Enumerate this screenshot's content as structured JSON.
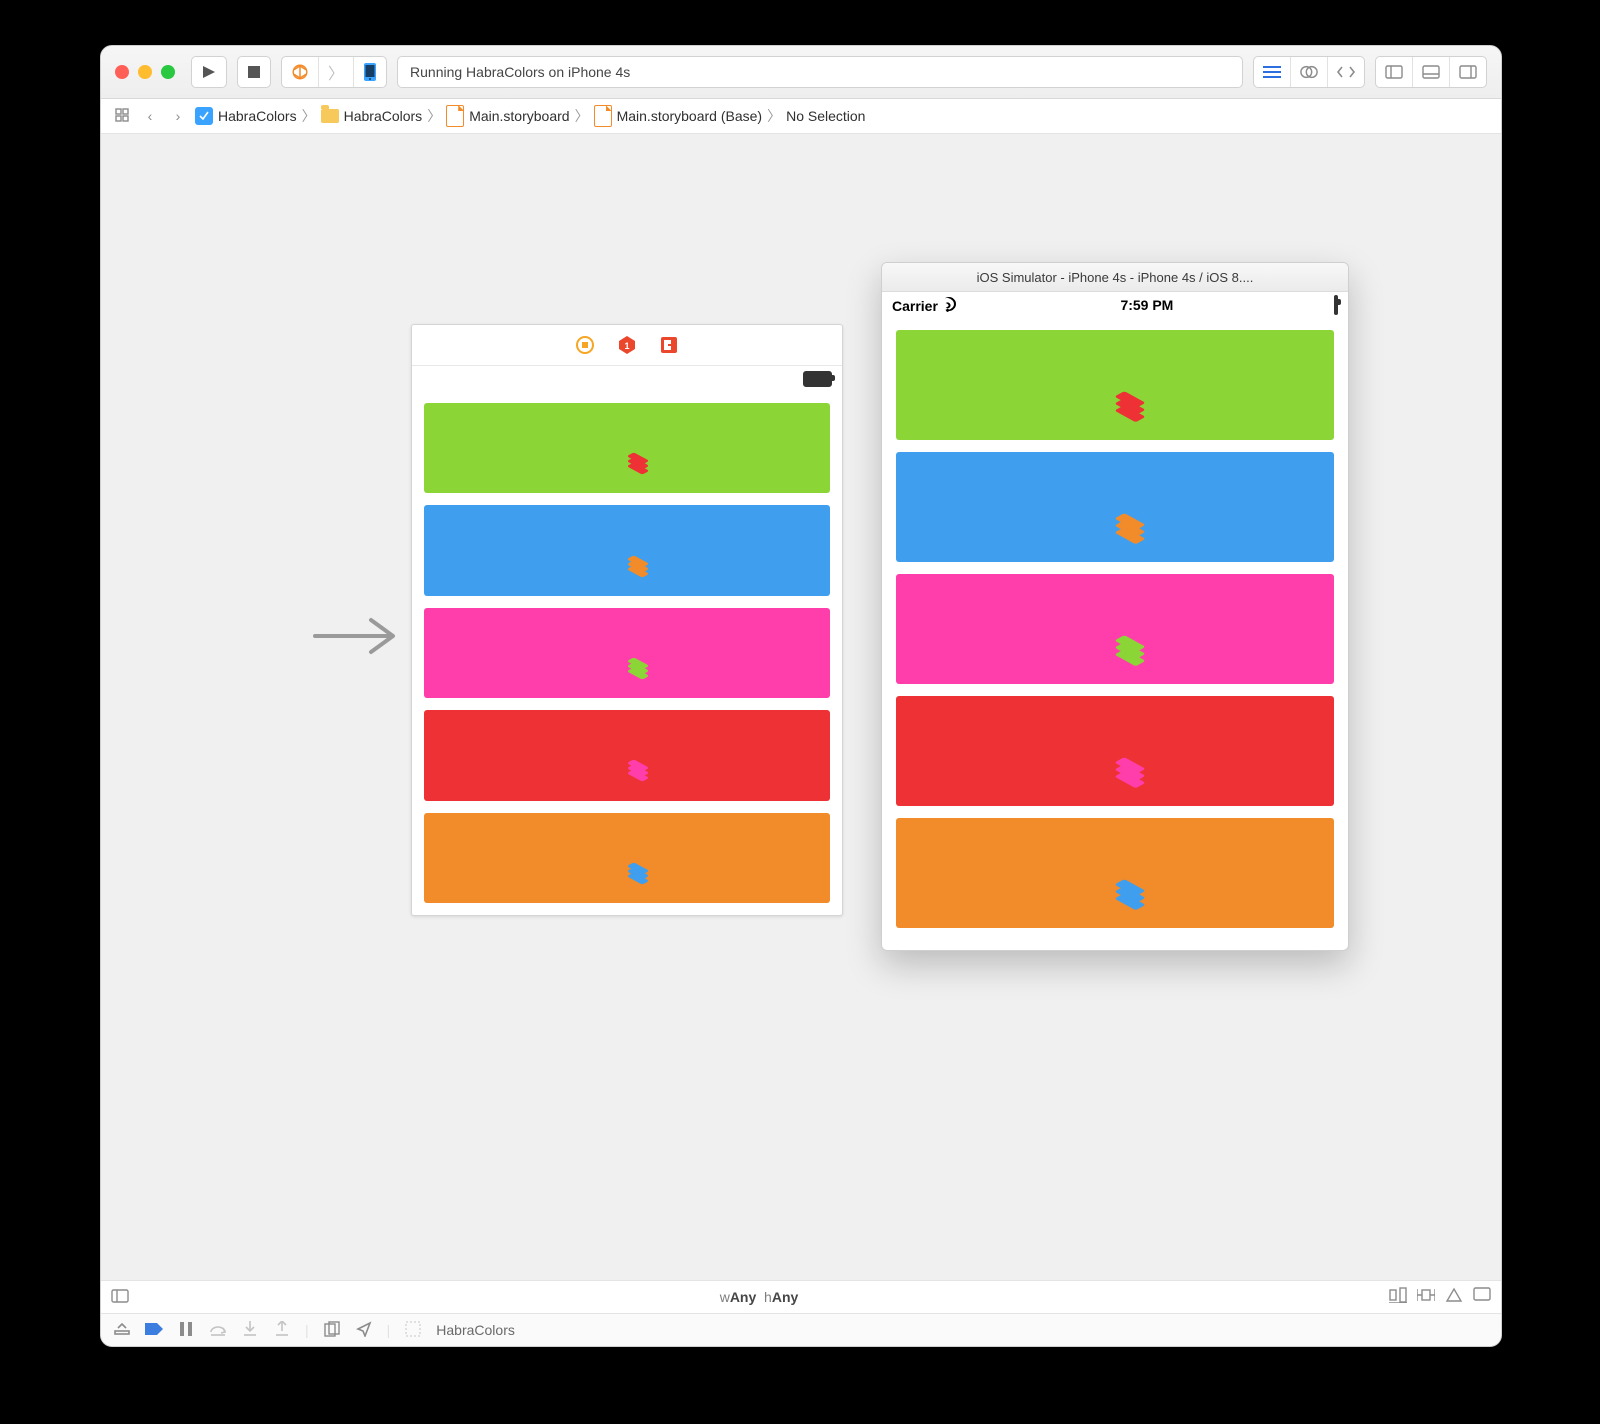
{
  "toolbar": {
    "status": "Running HabraColors on iPhone 4s"
  },
  "jumpbar": {
    "items": [
      "HabraColors",
      "HabraColors",
      "Main.storyboard",
      "Main.storyboard (Base)",
      "No Selection"
    ]
  },
  "simulator": {
    "title": "iOS Simulator - iPhone 4s - iPhone 4s / iOS 8....",
    "carrier": "Carrier",
    "time": "7:59 PM"
  },
  "sizebar": {
    "w_prefix": "w",
    "w_value": "Any",
    "h_prefix": "h",
    "h_value": "Any"
  },
  "debug": {
    "process": "HabraColors"
  },
  "scene_tiles": [
    {
      "bg": "#8bd636",
      "icon_color": "#ee3135",
      "name": "green"
    },
    {
      "bg": "#3f9fee",
      "icon_color": "#f28b29",
      "name": "blue"
    },
    {
      "bg": "#ff3eab",
      "icon_color": "#8bd636",
      "name": "pink"
    },
    {
      "bg": "#ee3135",
      "icon_color": "#ff3eab",
      "name": "red"
    },
    {
      "bg": "#f28b29",
      "icon_color": "#3f9fee",
      "name": "orange"
    }
  ],
  "simulator_tiles": [
    {
      "bg": "#8bd636",
      "icon_color": "#ee3135",
      "name": "green"
    },
    {
      "bg": "#3f9fee",
      "icon_color": "#f28b29",
      "name": "blue"
    },
    {
      "bg": "#ff3eab",
      "icon_color": "#8bd636",
      "name": "pink"
    },
    {
      "bg": "#ee3135",
      "icon_color": "#ff3eab",
      "name": "red"
    },
    {
      "bg": "#f28b29",
      "icon_color": "#3f9fee",
      "name": "orange"
    }
  ]
}
